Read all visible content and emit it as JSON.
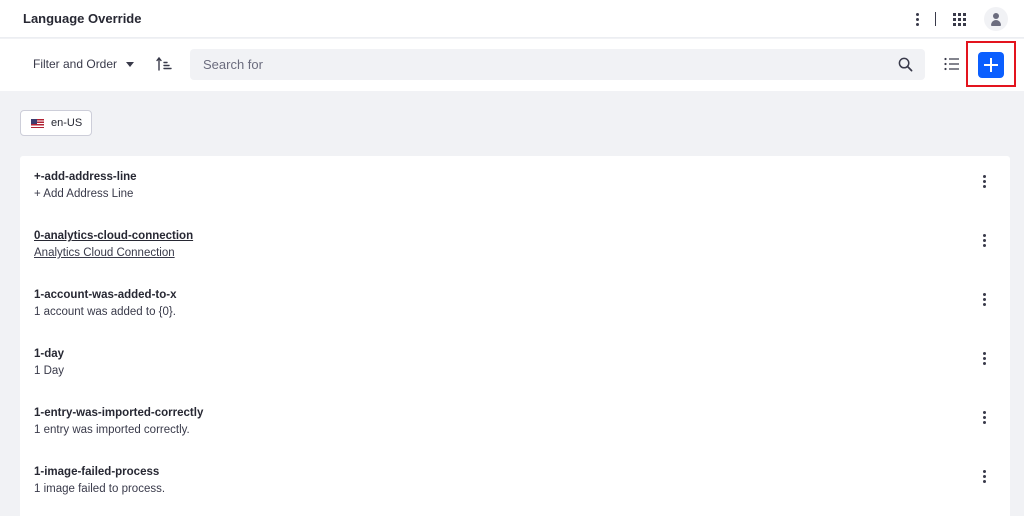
{
  "header": {
    "title": "Language Override"
  },
  "toolbar": {
    "filter_label": "Filter and Order",
    "search_placeholder": "Search for"
  },
  "locale": {
    "label": "en-US"
  },
  "entries": [
    {
      "key": "+-add-address-line",
      "value": "+ Add Address Line"
    },
    {
      "key": "0-analytics-cloud-connection",
      "value": "Analytics Cloud Connection"
    },
    {
      "key": "1-account-was-added-to-x",
      "value": "1 account was added to {0}."
    },
    {
      "key": "1-day",
      "value": "1 Day"
    },
    {
      "key": "1-entry-was-imported-correctly",
      "value": "1 entry was imported correctly."
    },
    {
      "key": "1-image-failed-process",
      "value": "1 image failed to process."
    }
  ],
  "colors": {
    "primary": "#0b5fff",
    "highlight": "#e3141e",
    "background": "#f1f2f5"
  }
}
